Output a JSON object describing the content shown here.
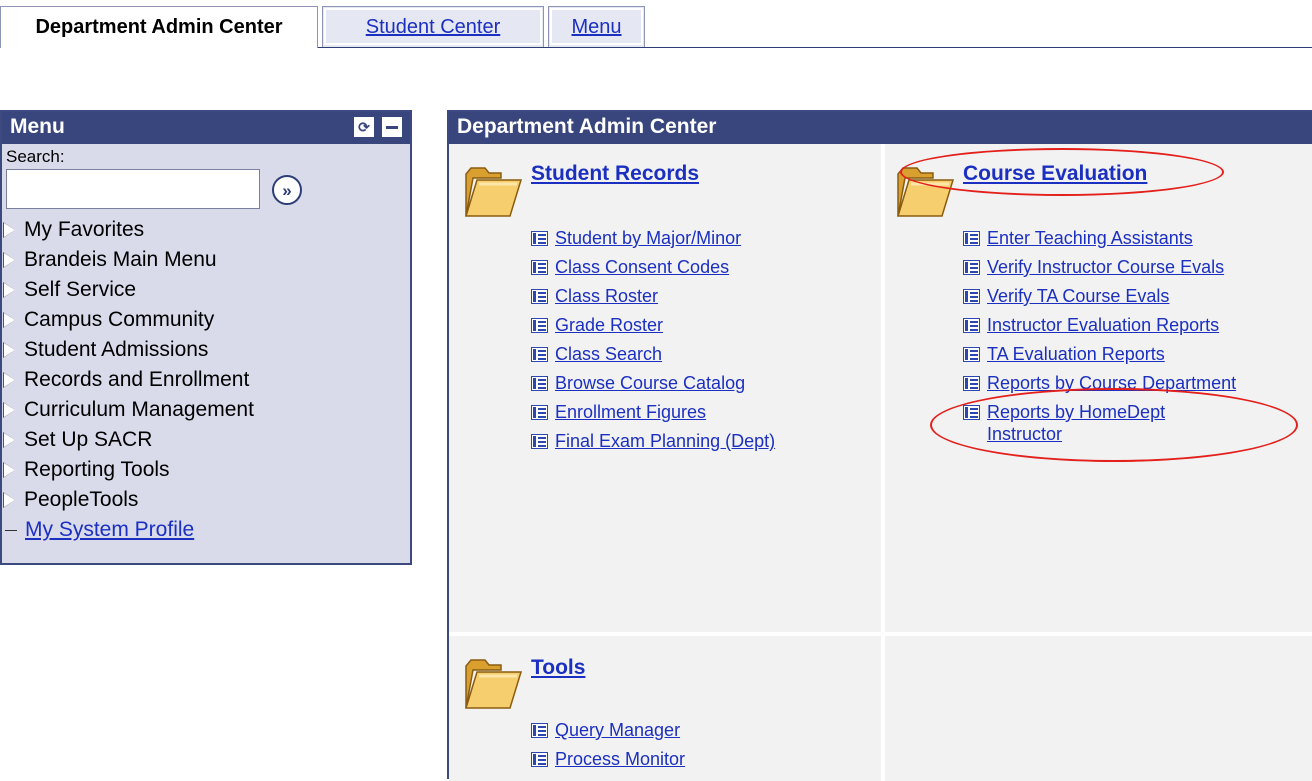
{
  "tabs": {
    "active": "Department Admin Center",
    "student_center": "Student Center",
    "menu": "Menu"
  },
  "menu_pagelet": {
    "title": "Menu",
    "search_label": "Search:",
    "search_value": "",
    "items": [
      {
        "label": "My Favorites",
        "type": "folder"
      },
      {
        "label": "Brandeis Main Menu",
        "type": "folder"
      },
      {
        "label": "Self Service",
        "type": "folder"
      },
      {
        "label": "Campus Community",
        "type": "folder"
      },
      {
        "label": "Student Admissions",
        "type": "folder"
      },
      {
        "label": "Records and Enrollment",
        "type": "folder"
      },
      {
        "label": "Curriculum Management",
        "type": "folder"
      },
      {
        "label": "Set Up SACR",
        "type": "folder"
      },
      {
        "label": "Reporting Tools",
        "type": "folder"
      },
      {
        "label": "PeopleTools",
        "type": "folder"
      },
      {
        "label": "My System Profile",
        "type": "link"
      }
    ]
  },
  "admin_center": {
    "title": "Department Admin Center",
    "student_records": {
      "title": "Student Records",
      "links": [
        "Student by Major/Minor",
        "Class Consent Codes",
        "Class Roster",
        "Grade Roster",
        "Class Search",
        "Browse Course Catalog",
        "Enrollment Figures",
        "Final Exam Planning (Dept)"
      ]
    },
    "course_evaluation": {
      "title": "Course Evaluation",
      "links": [
        "Enter Teaching Assistants",
        "Verify Instructor Course Evals",
        "Verify TA Course Evals",
        "Instructor Evaluation Reports",
        "TA Evaluation Reports",
        "Reports by Course Department"
      ],
      "two_line_link": {
        "line1": "Reports by HomeDept",
        "line2": "Instructor"
      }
    },
    "tools": {
      "title": "Tools",
      "links": [
        "Query Manager",
        "Process Monitor"
      ]
    }
  },
  "colors": {
    "header_bg": "#39467e",
    "link": "#1b2fc0",
    "menu_bg": "#d9dbeb",
    "cell_bg": "#f2f2f2",
    "annotation": "#e3201b"
  }
}
